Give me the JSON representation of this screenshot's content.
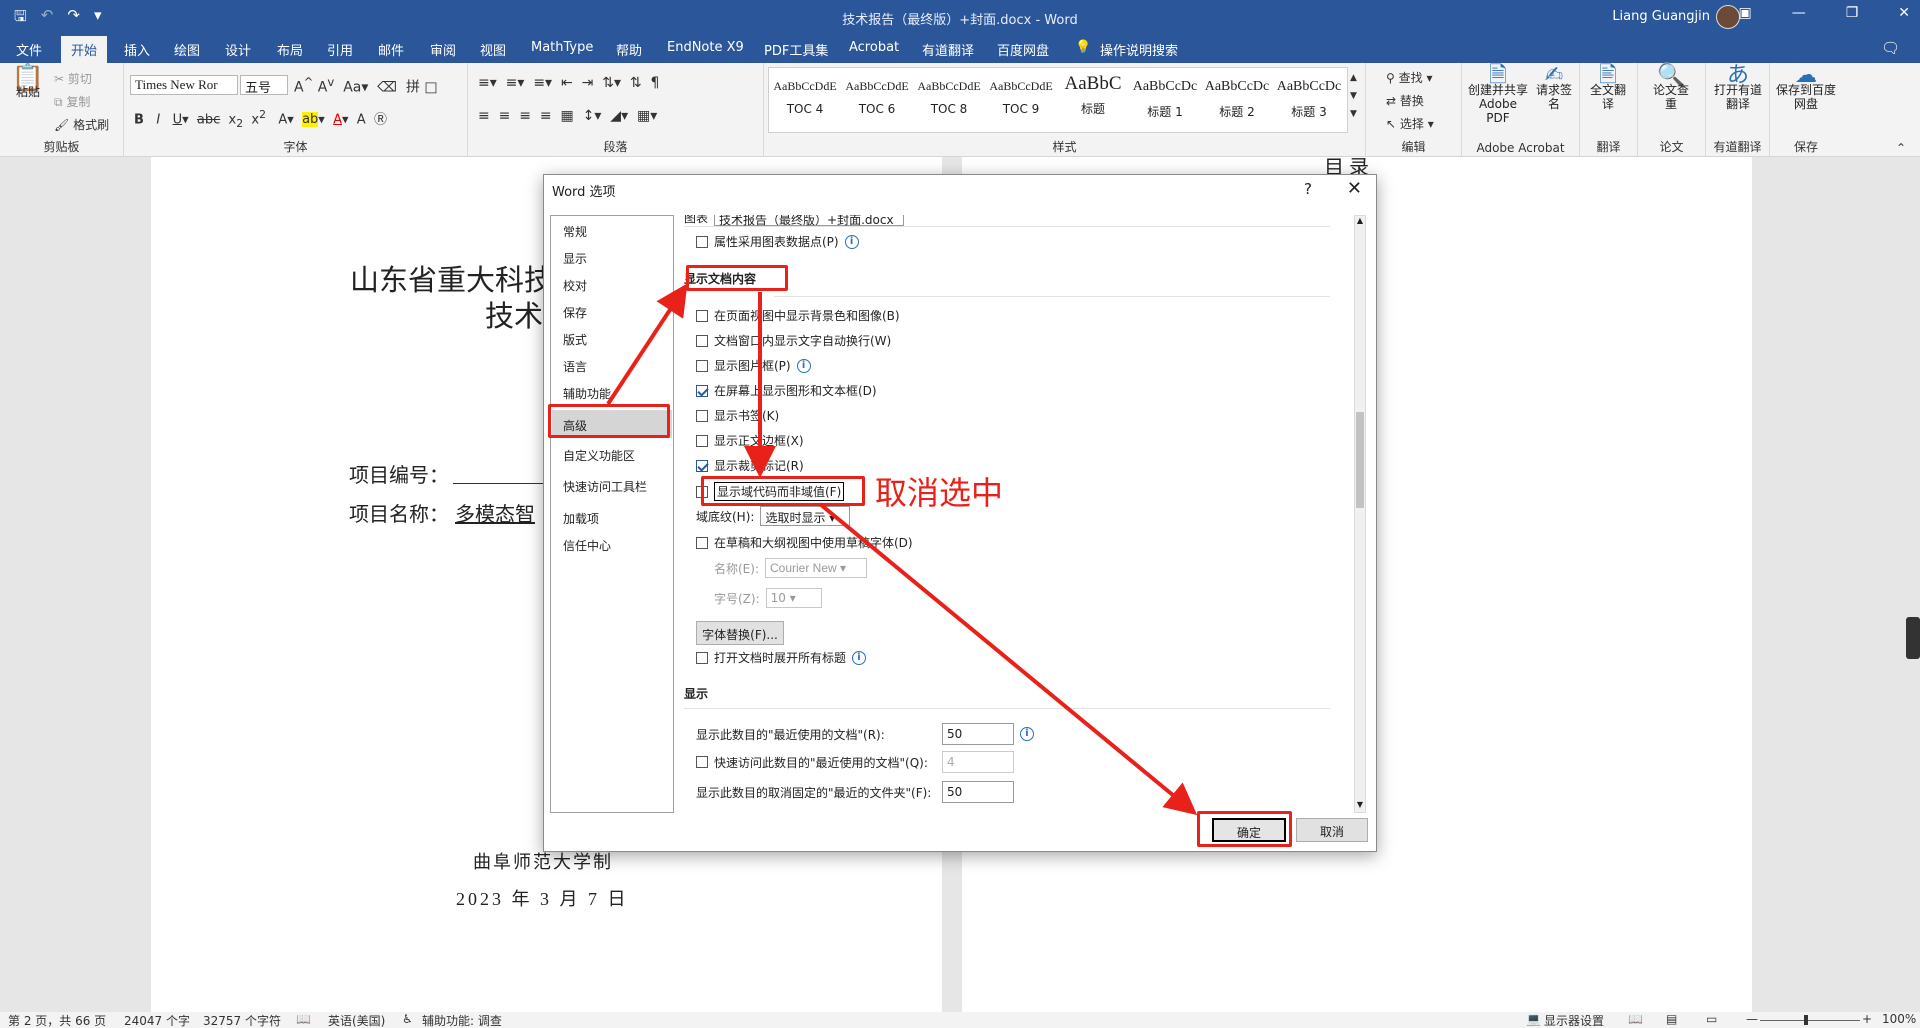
{
  "titlebar": {
    "document_title": "技术报告（最终版）+封面.docx - Word",
    "user_name": "Liang Guangjin"
  },
  "tabs": [
    "文件",
    "开始",
    "插入",
    "绘图",
    "设计",
    "布局",
    "引用",
    "邮件",
    "审阅",
    "视图",
    "MathType",
    "帮助",
    "EndNote X9",
    "PDF工具集",
    "Acrobat",
    "有道翻译",
    "百度网盘",
    "操作说明搜索"
  ],
  "ribbon": {
    "clipboard": {
      "label": "剪贴板",
      "paste": "粘贴",
      "cut": "剪切",
      "copy": "复制",
      "format_painter": "格式刷"
    },
    "font": {
      "label": "字体",
      "font_name": "Times New Ror",
      "font_size": "五号"
    },
    "paragraph": {
      "label": "段落"
    },
    "styles": {
      "label": "样式",
      "items": [
        {
          "sample": "AaBbCcDdE",
          "name": "TOC 4"
        },
        {
          "sample": "AaBbCcDdE",
          "name": "TOC 6"
        },
        {
          "sample": "AaBbCcDdE",
          "name": "TOC 8"
        },
        {
          "sample": "AaBbCcDdE",
          "name": "TOC 9"
        },
        {
          "sample": "AaBbC",
          "name": "标题"
        },
        {
          "sample": "AaBbCcDc",
          "name": "标题 1"
        },
        {
          "sample": "AaBbCcDc",
          "name": "标题 2"
        },
        {
          "sample": "AaBbCcDc",
          "name": "标题 3"
        }
      ]
    },
    "editing": {
      "label": "编辑",
      "find": "查找",
      "replace": "替换",
      "select": "选择"
    },
    "adobe": {
      "label": "Adobe Acrobat",
      "create_share": "创建并共享 Adobe PDF",
      "request_sign": "请求签名"
    },
    "translate": {
      "label": "翻译",
      "full_text": "全文翻译"
    },
    "paper": {
      "label": "论文",
      "check": "论文查重"
    },
    "youdao": {
      "label": "有道翻译",
      "open": "打开有道翻译"
    },
    "save": {
      "label": "保存",
      "to_baidu": "保存到百度网盘"
    }
  },
  "document": {
    "cover_title_line1": "山东省重大科技",
    "cover_title_line2": "技术",
    "project_number_label": "项目编号：",
    "project_name_label": "项目名称：",
    "project_name_value": "多模态智",
    "institution": "曲阜师范大学制",
    "date": "2023 年 3 月 7 日",
    "right_page_heading": "目 录"
  },
  "dialog": {
    "title": "Word 选项",
    "help": "?",
    "nav": [
      "常规",
      "显示",
      "校对",
      "保存",
      "版式",
      "语言",
      "辅助功能",
      "高级",
      "自定义功能区",
      "快速访问工具栏",
      "加载项",
      "信任中心"
    ],
    "selected_nav": "高级",
    "top_row_fragment": "图表",
    "top_row_combo": "技术报告（最终版）+封面.docx",
    "chart_data_points": "属性采用图表数据点(P)",
    "section_show_content": "显示文档内容",
    "options": [
      {
        "label": "在页面视图中显示背景色和图像(B)",
        "checked": false
      },
      {
        "label": "文档窗口内显示文字自动换行(W)",
        "checked": false
      },
      {
        "label": "显示图片框(P)",
        "checked": false,
        "info": true
      },
      {
        "label": "在屏幕上显示图形和文本框(D)",
        "checked": true
      },
      {
        "label": "显示书签(K)",
        "checked": false
      },
      {
        "label": "显示正文边框(X)",
        "checked": false
      },
      {
        "label": "显示裁剪标记(R)",
        "checked": true
      },
      {
        "label": "显示域代码而非域值(F)",
        "checked": false
      }
    ],
    "field_shading_label": "域底纹(H):",
    "field_shading_value": "选取时显示",
    "draft_font_label": "在草稿和大纲视图中使用草稿字体(D)",
    "draft_name_label": "名称(E):",
    "draft_name_value": "Courier New",
    "draft_size_label": "字号(Z):",
    "draft_size_value": "10",
    "font_substitution": "字体替换(F)...",
    "expand_headings": "打开文档时展开所有标题",
    "section_display": "显示",
    "recent_docs_label": "显示此数目的\"最近使用的文档\"(R):",
    "recent_docs_value": "50",
    "quick_access_label": "快速访问此数目的\"最近使用的文档\"(Q):",
    "quick_access_value": "4",
    "unpinned_folders_label": "显示此数目的取消固定的\"最近的文件夹\"(F):",
    "unpinned_folders_value": "50",
    "ok": "确定",
    "cancel": "取消"
  },
  "annotation": {
    "text": "取消选中",
    "color": "#e8221a"
  },
  "status": {
    "page": "第 2 页，共 66 页",
    "words": "24047 个字",
    "chars": "32757 个字符",
    "language": "英语(美国)",
    "accessibility": "辅助功能: 调查",
    "display_settings": "显示器设置",
    "zoom": "100%"
  },
  "colors": {
    "accent": "#2b579a",
    "annotation": "#e8221a"
  }
}
